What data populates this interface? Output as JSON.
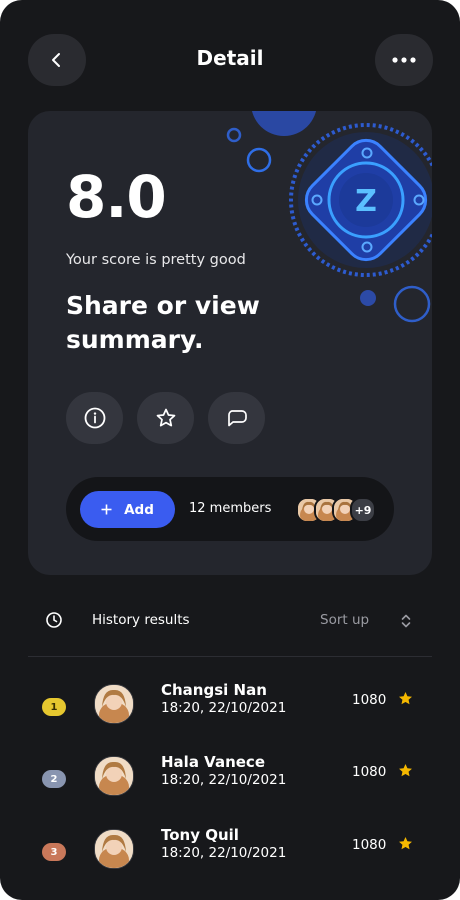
{
  "header": {
    "title": "Detail",
    "back_icon": "chevron-left-icon",
    "menu_icon": "more-horizontal-icon"
  },
  "summary": {
    "score": "8.0",
    "subtitle": "Your score is pretty good",
    "headline": "Share or view summary.",
    "actions": [
      {
        "icon": "info-icon"
      },
      {
        "icon": "star-outline-icon"
      },
      {
        "icon": "chat-bubble-icon"
      }
    ],
    "add_label": "Add",
    "members_label": "12 members",
    "members_more": "+9",
    "badge_letter": "Z"
  },
  "history": {
    "title": "History results",
    "sort_label": "Sort up",
    "rows": [
      {
        "rank": "1",
        "name": "Changsi Nan",
        "time": "18:20, 22/10/2021",
        "points": "1080",
        "rank_color": "#e6c72f",
        "rank_text_color": "#3a3000"
      },
      {
        "rank": "2",
        "name": "Hala Vanece",
        "time": "18:20, 22/10/2021",
        "points": "1080",
        "rank_color": "#8995b0",
        "rank_text_color": "#ffffff"
      },
      {
        "rank": "3",
        "name": "Tony Quil",
        "time": "18:20, 22/10/2021",
        "points": "1080",
        "rank_color": "#c9785a",
        "rank_text_color": "#ffffff"
      }
    ]
  },
  "colors": {
    "background": "#17181b",
    "card": "#24262d",
    "accent": "#3a5cf0",
    "star": "#f5b800",
    "badge_blue": "#2f74e6"
  }
}
